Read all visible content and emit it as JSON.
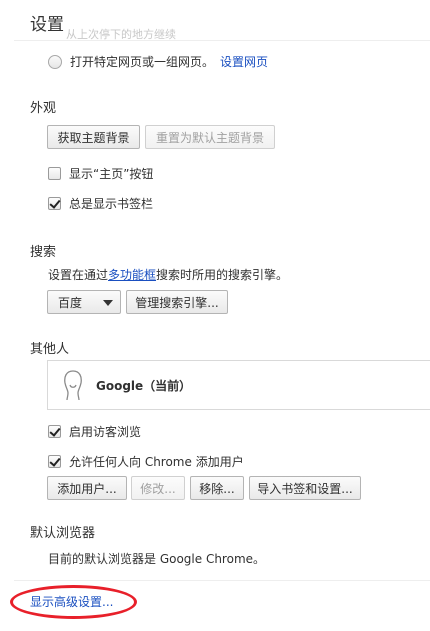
{
  "page": {
    "title": "设置",
    "faded_text": "从上次停下的地方继续"
  },
  "startup": {
    "radio_label": "打开特定网页或一组网页。",
    "set_pages_link": "设置网页"
  },
  "appearance": {
    "heading": "外观",
    "get_themes_button": "获取主题背景",
    "reset_theme_button": "重置为默认主题背景",
    "show_home_label": "显示“主页”按钮",
    "show_home_checked": false,
    "show_bookmarks_label": "总是显示书签栏",
    "show_bookmarks_checked": true
  },
  "search": {
    "heading": "搜索",
    "desc_prefix": "设置在通过",
    "desc_link": "多功能框",
    "desc_suffix": "搜索时所用的搜索引擎。",
    "engine_selected": "百度",
    "manage_button": "管理搜索引擎..."
  },
  "people": {
    "heading": "其他人",
    "profile_name": "Google（当前）",
    "guest_label": "启用访客浏览",
    "guest_checked": true,
    "allow_add_label": "允许任何人向 Chrome 添加用户",
    "allow_add_checked": true,
    "add_user_button": "添加用户...",
    "edit_button": "修改...",
    "remove_button": "移除...",
    "import_button": "导入书签和设置..."
  },
  "default_browser": {
    "heading": "默认浏览器",
    "status_text": "目前的默认浏览器是 Google Chrome。"
  },
  "advanced": {
    "show_link": "显示高级设置..."
  },
  "colors": {
    "link": "#1a4fc0",
    "annotation_ellipse": "#e8202a"
  }
}
